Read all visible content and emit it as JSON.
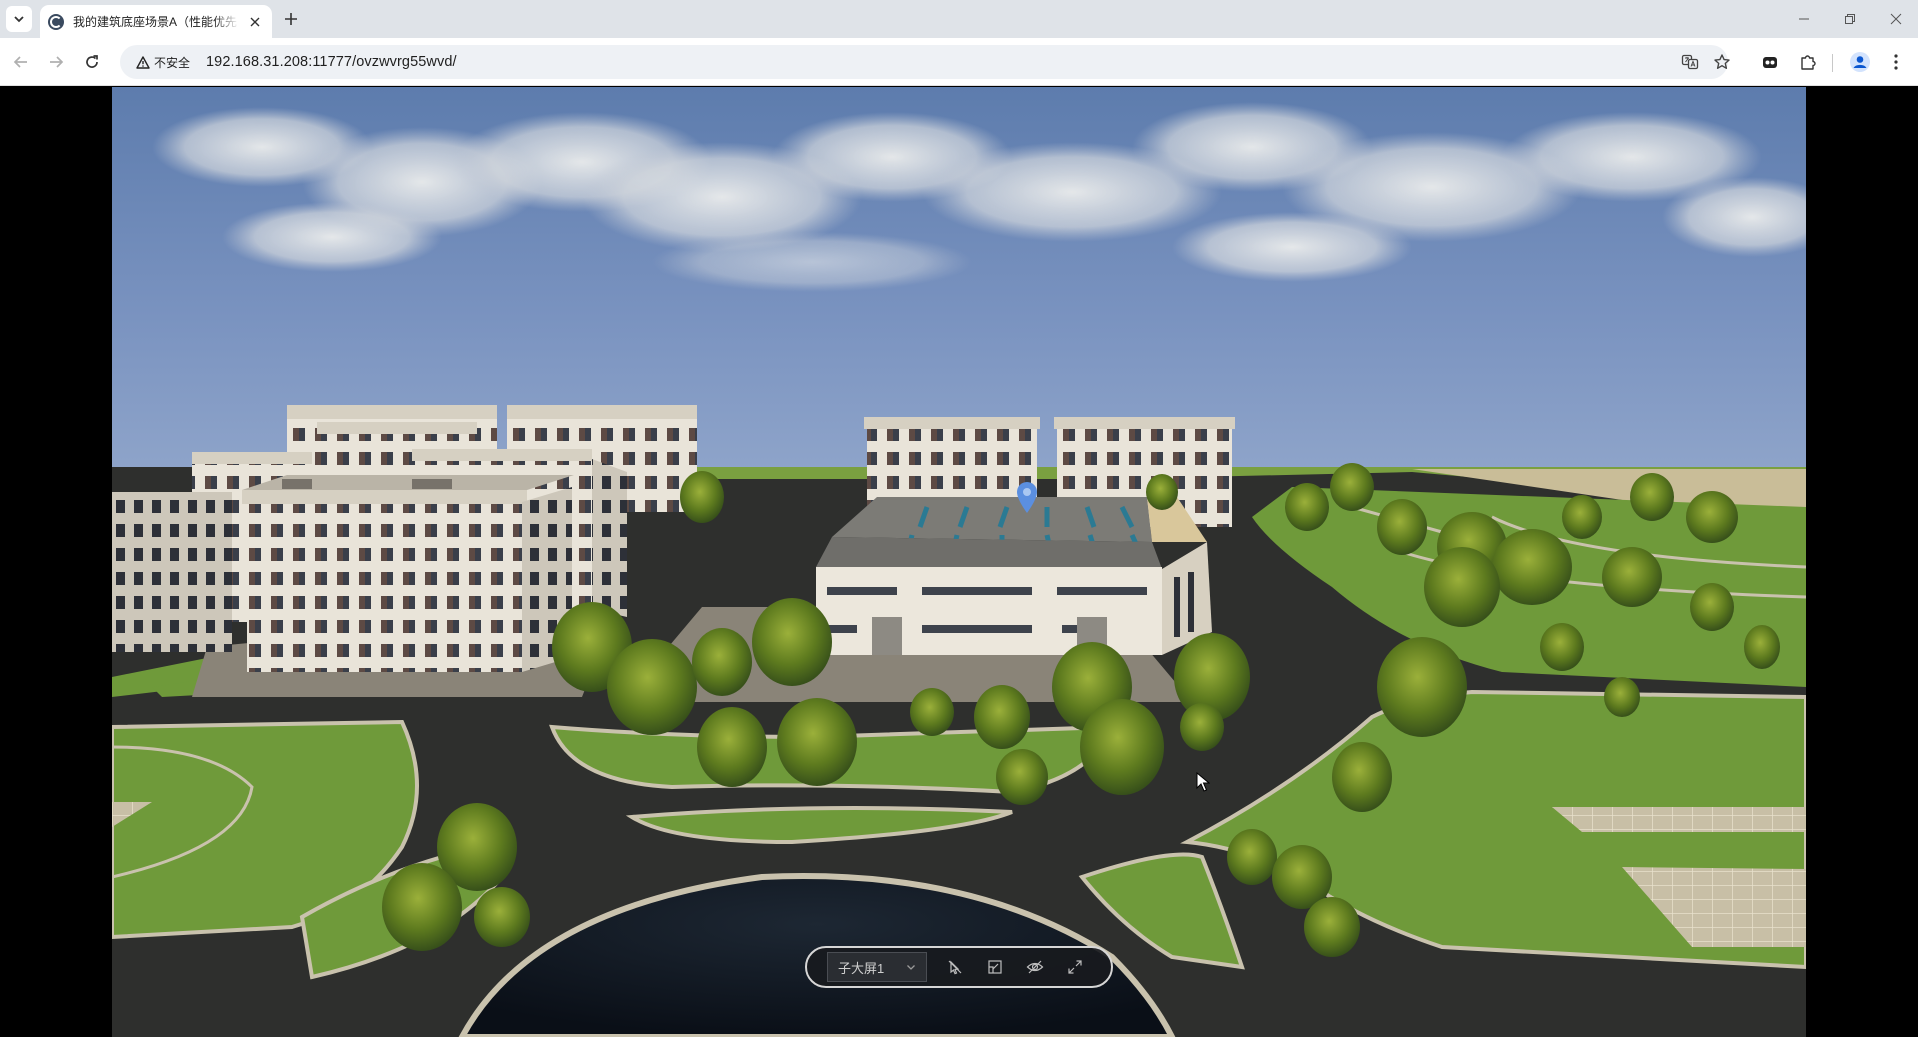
{
  "browser": {
    "tab_title": "我的建筑底座场景A（性能优先",
    "security_label": "不安全",
    "url": "192.168.31.208:11777/ovzwvrg55wvd/"
  },
  "controls": {
    "screen_select_value": "子大屏1"
  },
  "icons": {
    "tab_search": "chevron-down-icon",
    "close": "close-icon",
    "new_tab": "plus-icon",
    "back": "arrow-left-icon",
    "forward": "arrow-right-icon",
    "reload": "reload-icon",
    "warning": "warning-icon",
    "translate": "translate-icon",
    "bookmark": "star-icon",
    "extension": "puzzle-icon",
    "profile": "profile-icon",
    "menu": "kebab-menu-icon"
  },
  "colors": {
    "sky_top": "#5d7cad",
    "sky_horizon": "#8da2c8",
    "grass": "#6f9a3a",
    "road": "#2b2b2b",
    "marker": "#5b8fe0"
  }
}
